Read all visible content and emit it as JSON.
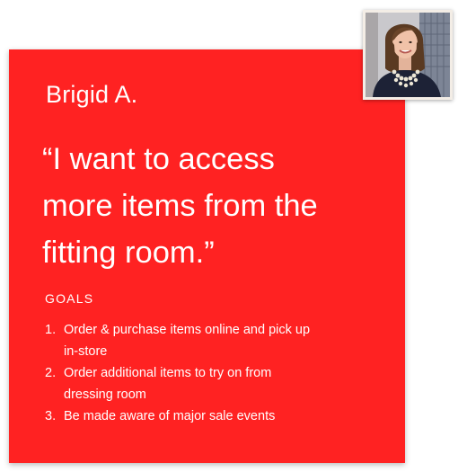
{
  "persona": {
    "name": "Brigid A.",
    "quote_lines": [
      "“I want to access",
      "more items from the",
      "fitting room.”"
    ]
  },
  "goals": {
    "heading": "GOALS",
    "items": [
      {
        "number": "1.",
        "line1": "Order & purchase items online and pick up",
        "line2": "in-store"
      },
      {
        "number": "2.",
        "line1": "Order additional items to try on from",
        "line2": "dressing room"
      },
      {
        "number": "3.",
        "line1": "Be made aware of major sale events",
        "line2": ""
      }
    ]
  },
  "colors": {
    "card_background": "#ff2222",
    "text": "#ffffff"
  }
}
